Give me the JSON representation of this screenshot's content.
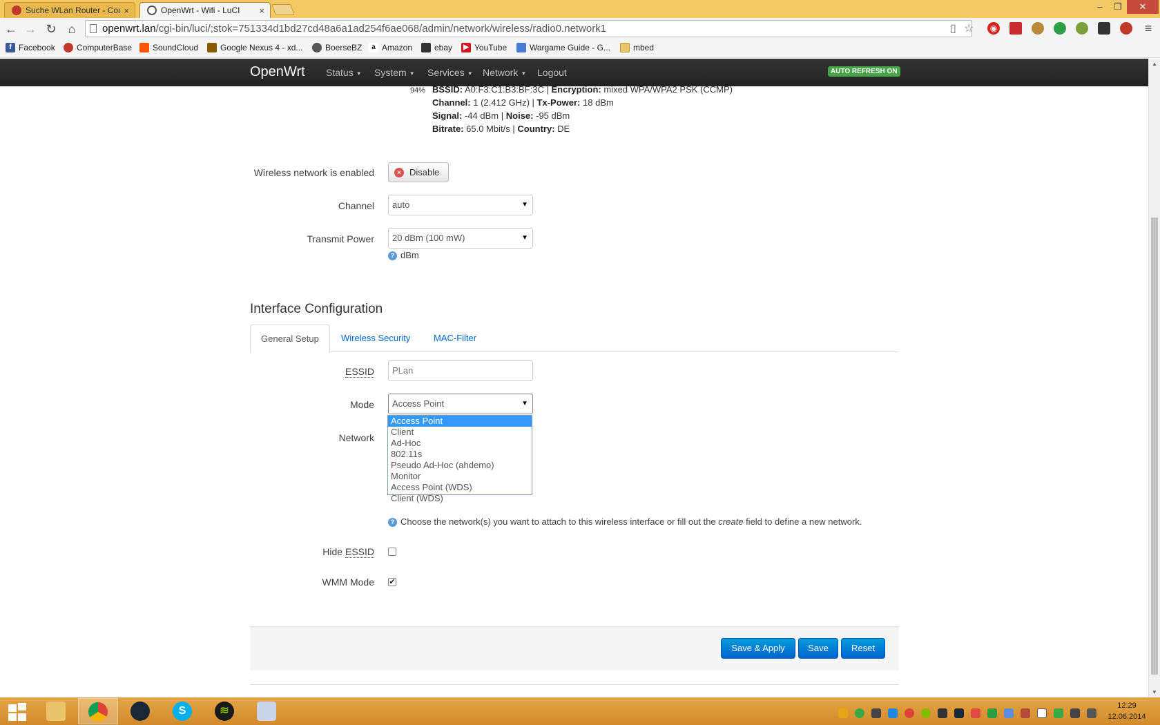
{
  "browser": {
    "tabs": [
      {
        "title": "Suche WLan Router - Con",
        "active": false
      },
      {
        "title": "OpenWrt - Wifi - LuCI",
        "active": true
      }
    ],
    "url_host": "openwrt.lan",
    "url_path": "/cgi-bin/luci/;stok=751334d1bd27cd48a6a1ad254f6ae068/admin/network/wireless/radio0.network1",
    "bookmarks": [
      "Facebook",
      "ComputerBase",
      "SoundCloud",
      "Google Nexus 4 - xd...",
      "BoerseBZ",
      "Amazon",
      "ebay",
      "YouTube",
      "Wargame Guide - G...",
      "mbed"
    ]
  },
  "header": {
    "brand": "OpenWrt",
    "nav": [
      "Status",
      "System",
      "Services",
      "Network",
      "Logout"
    ],
    "auto_refresh": "AUTO REFRESH ON"
  },
  "status": {
    "signal_pct": "94%",
    "bssid_label": "BSSID:",
    "bssid": "A0:F3:C1:B3:BF:3C",
    "encryption_label": "Encryption:",
    "encryption": "mixed WPA/WPA2 PSK (CCMP)",
    "channel_label": "Channel:",
    "channel": "1 (2.412 GHz)",
    "txpower_label": "Tx-Power:",
    "txpower": "18 dBm",
    "signal_label": "Signal:",
    "signal": "-44 dBm",
    "noise_label": "Noise:",
    "noise": "-95 dBm",
    "bitrate_label": "Bitrate:",
    "bitrate": "65.0 Mbit/s",
    "country_label": "Country:",
    "country": "DE",
    "separator": "|"
  },
  "device": {
    "enabled_label": "Wireless network is enabled",
    "disable_button": "Disable",
    "channel_label": "Channel",
    "channel_value": "auto",
    "txpower_label": "Transmit Power",
    "txpower_value": "20 dBm (100 mW)",
    "txpower_help": "dBm"
  },
  "interface": {
    "title": "Interface Configuration",
    "tabs": [
      "General Setup",
      "Wireless Security",
      "MAC-Filter"
    ],
    "essid_label": "ESSID",
    "essid_value": "PLan",
    "mode_label": "Mode",
    "mode_value": "Access Point",
    "mode_options": [
      "Access Point",
      "Client",
      "Ad-Hoc",
      "802.11s",
      "Pseudo Ad-Hoc (ahdemo)",
      "Monitor",
      "Access Point (WDS)",
      "Client (WDS)"
    ],
    "network_label": "Network",
    "network_help_pre": "Choose the network(s) you want to attach to this wireless interface or fill out the",
    "network_help_em": "create",
    "network_help_post": "field to define a new network.",
    "hide_label_pre": "Hide",
    "hide_label_abbr": "ESSID",
    "hide_checked": false,
    "wmm_label": "WMM Mode",
    "wmm_checked": true
  },
  "actions": {
    "save_apply": "Save & Apply",
    "save": "Save",
    "reset": "Reset"
  },
  "taskbar": {
    "time": "12:29",
    "date": "12.06.2014"
  }
}
